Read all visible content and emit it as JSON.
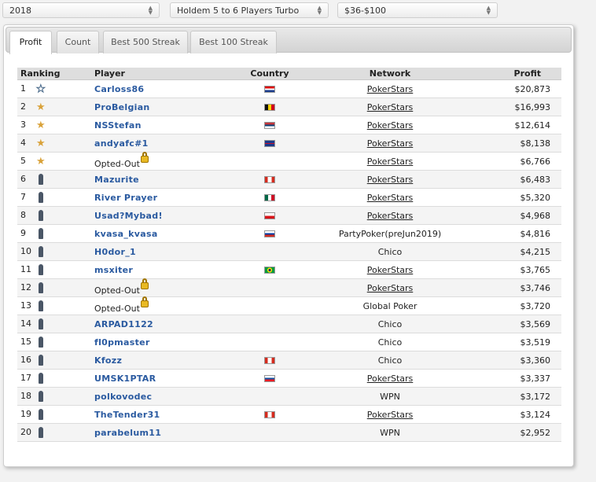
{
  "filters": {
    "year": "2018",
    "game": "Holdem 5 to 6 Players Turbo",
    "stake": "$36-$100"
  },
  "tabs": [
    {
      "label": "Profit",
      "active": true
    },
    {
      "label": "Count",
      "active": false
    },
    {
      "label": "Best 500 Streak",
      "active": false
    },
    {
      "label": "Best 100 Streak",
      "active": false
    }
  ],
  "table": {
    "headers": {
      "ranking": "Ranking",
      "player": "Player",
      "country": "Country",
      "network": "Network",
      "profit": "Profit"
    },
    "opted_out_label": "Opted-Out",
    "rows": [
      {
        "rank": "1",
        "player": "Carloss86",
        "icon": "outline-star-icon",
        "flag": "croatia-flag",
        "network": "PokerStars",
        "network_link": true,
        "profit": "$20,873"
      },
      {
        "rank": "2",
        "player": "ProBelgian",
        "icon": "gold-star-icon",
        "flag": "belgium-flag",
        "network": "PokerStars",
        "network_link": true,
        "profit": "$16,993"
      },
      {
        "rank": "3",
        "player": "NSStefan",
        "icon": "gold-star-icon",
        "flag": "serbia-flag",
        "network": "PokerStars",
        "network_link": true,
        "profit": "$12,614"
      },
      {
        "rank": "4",
        "player": "andyafc#1",
        "icon": "gold-star-icon",
        "flag": "uk-flag",
        "network": "PokerStars",
        "network_link": true,
        "profit": "$8,138"
      },
      {
        "rank": "5",
        "player": "",
        "opted_out": true,
        "icon": "gold-star-icon",
        "flag": "",
        "network": "PokerStars",
        "network_link": true,
        "profit": "$6,766"
      },
      {
        "rank": "6",
        "player": "Mazurite",
        "icon": "chip-icon",
        "flag": "canada-flag",
        "network": "PokerStars",
        "network_link": true,
        "profit": "$6,483"
      },
      {
        "rank": "7",
        "player": "River Prayer",
        "icon": "chip-icon",
        "flag": "mexico-flag",
        "network": "PokerStars",
        "network_link": true,
        "profit": "$5,320"
      },
      {
        "rank": "8",
        "player": "Usad?Mybad!",
        "icon": "chip-icon",
        "flag": "czech-flag",
        "network": "PokerStars",
        "network_link": true,
        "profit": "$4,968"
      },
      {
        "rank": "9",
        "player": "kvasa_kvasa",
        "icon": "chip-icon",
        "flag": "russia-flag",
        "network": "PartyPoker(preJun2019)",
        "network_link": false,
        "profit": "$4,816"
      },
      {
        "rank": "10",
        "player": "H0dor_1",
        "icon": "chip-icon",
        "flag": "",
        "network": "Chico",
        "network_link": false,
        "profit": "$4,215"
      },
      {
        "rank": "11",
        "player": "msxiter",
        "icon": "chip-icon",
        "flag": "brazil-flag",
        "network": "PokerStars",
        "network_link": true,
        "profit": "$3,765"
      },
      {
        "rank": "12",
        "player": "",
        "opted_out": true,
        "icon": "chip-icon",
        "flag": "",
        "network": "PokerStars",
        "network_link": true,
        "profit": "$3,746"
      },
      {
        "rank": "13",
        "player": "",
        "opted_out": true,
        "icon": "chip-icon",
        "flag": "",
        "network": "Global Poker",
        "network_link": false,
        "profit": "$3,720"
      },
      {
        "rank": "14",
        "player": "ARPAD1122",
        "icon": "chip-icon",
        "flag": "",
        "network": "Chico",
        "network_link": false,
        "profit": "$3,569"
      },
      {
        "rank": "15",
        "player": "fl0pmaster",
        "icon": "chip-icon",
        "flag": "",
        "network": "Chico",
        "network_link": false,
        "profit": "$3,519"
      },
      {
        "rank": "16",
        "player": "Kfozz",
        "icon": "chip-icon",
        "flag": "canada-flag",
        "network": "Chico",
        "network_link": false,
        "profit": "$3,360"
      },
      {
        "rank": "17",
        "player": "UMSK1PTAR",
        "icon": "chip-icon",
        "flag": "slovakia-flag",
        "network": "PokerStars",
        "network_link": true,
        "profit": "$3,337"
      },
      {
        "rank": "18",
        "player": "polkovodec",
        "icon": "chip-icon",
        "flag": "",
        "network": "WPN",
        "network_link": false,
        "profit": "$3,172"
      },
      {
        "rank": "19",
        "player": "TheTender31",
        "icon": "chip-icon",
        "flag": "canada-flag",
        "network": "PokerStars",
        "network_link": true,
        "profit": "$3,124"
      },
      {
        "rank": "20",
        "player": "parabelum11",
        "icon": "chip-icon",
        "flag": "",
        "network": "WPN",
        "network_link": false,
        "profit": "$2,952"
      }
    ]
  },
  "colors": {
    "player_link": "#2a5aa0",
    "gold_star": "#d9a23a",
    "chip": "#4a5666"
  }
}
